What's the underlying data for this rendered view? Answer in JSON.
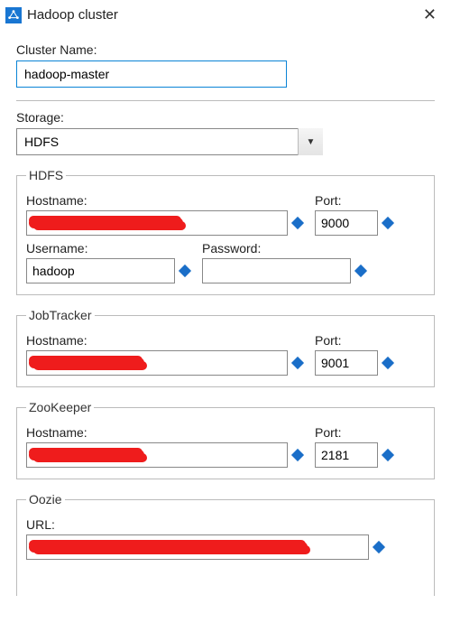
{
  "title": "Hadoop cluster",
  "clusterName": {
    "label": "Cluster Name:",
    "value": "hadoop-master"
  },
  "storage": {
    "label": "Storage:",
    "selected": "HDFS"
  },
  "groups": {
    "hdfs": {
      "legend": "HDFS",
      "hostnameLabel": "Hostname:",
      "hostnameValue": "",
      "portLabel": "Port:",
      "portValue": "9000",
      "usernameLabel": "Username:",
      "usernameValue": "hadoop",
      "passwordLabel": "Password:",
      "passwordValue": ""
    },
    "jobtracker": {
      "legend": "JobTracker",
      "hostnameLabel": "Hostname:",
      "hostnameValue": "",
      "portLabel": "Port:",
      "portValue": "9001"
    },
    "zookeeper": {
      "legend": "ZooKeeper",
      "hostnameLabel": "Hostname:",
      "hostnameValue": "",
      "portLabel": "Port:",
      "portValue": "2181"
    },
    "oozie": {
      "legend": "Oozie",
      "urlLabel": "URL:",
      "urlValue": ""
    }
  }
}
